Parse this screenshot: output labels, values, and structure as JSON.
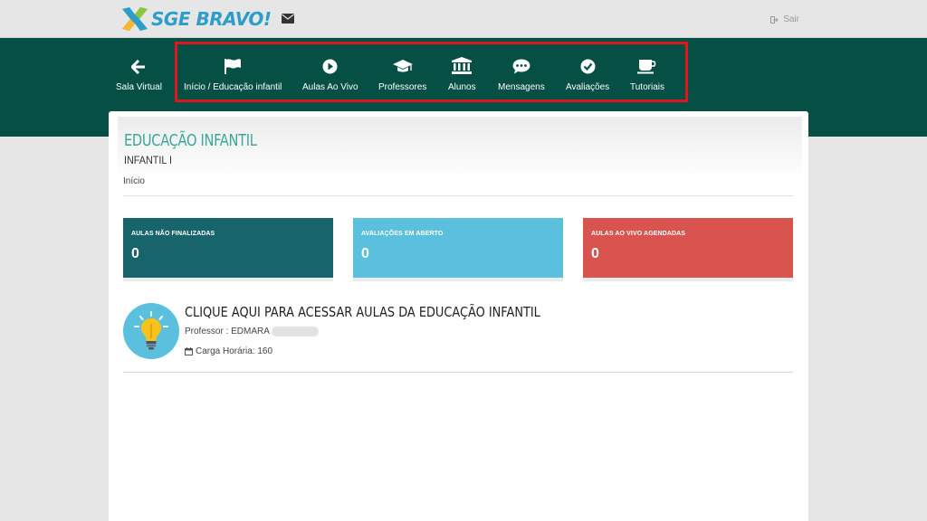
{
  "app": {
    "brand": "SGE BRAVO!",
    "logout_label": "Sair"
  },
  "nav": {
    "items": [
      {
        "label": "Sala Virtual",
        "icon": "arrow-left-icon"
      },
      {
        "label": "Início / Educação infantil",
        "icon": "flag-icon"
      },
      {
        "label": "Aulas Ao Vivo",
        "icon": "play-circle-icon"
      },
      {
        "label": "Professores",
        "icon": "graduation-cap-icon"
      },
      {
        "label": "Alunos",
        "icon": "institution-icon"
      },
      {
        "label": "Mensagens",
        "icon": "comment-dots-icon"
      },
      {
        "label": "Avaliações",
        "icon": "check-circle-icon"
      },
      {
        "label": "Tutoriais",
        "icon": "coffee-cup-icon"
      }
    ]
  },
  "page": {
    "title": "EDUCAÇÃO INFANTIL",
    "subtitle": "INFANTIL I",
    "breadcrumb": "Início"
  },
  "stats": [
    {
      "label": "AULAS NÃO FINALIZADAS",
      "value": "0",
      "color": "#17646a"
    },
    {
      "label": "AVALIAÇÕES EM ABERTO",
      "value": "0",
      "color": "#5bc0de"
    },
    {
      "label": "AULAS AO VIVO AGENDADAS",
      "value": "0",
      "color": "#d9534f"
    }
  ],
  "course": {
    "title": "CLIQUE AQUI PARA ACESSAR AULAS DA EDUCAÇÃO INFANTIL",
    "teacher": "Professor : EDMARA",
    "hours": "Carga Horária: 160",
    "icon": "lightbulb-icon"
  },
  "colors": {
    "nav_background": "#054f44",
    "accent_title": "#3aa79a",
    "highlight_border": "#e0161c"
  }
}
